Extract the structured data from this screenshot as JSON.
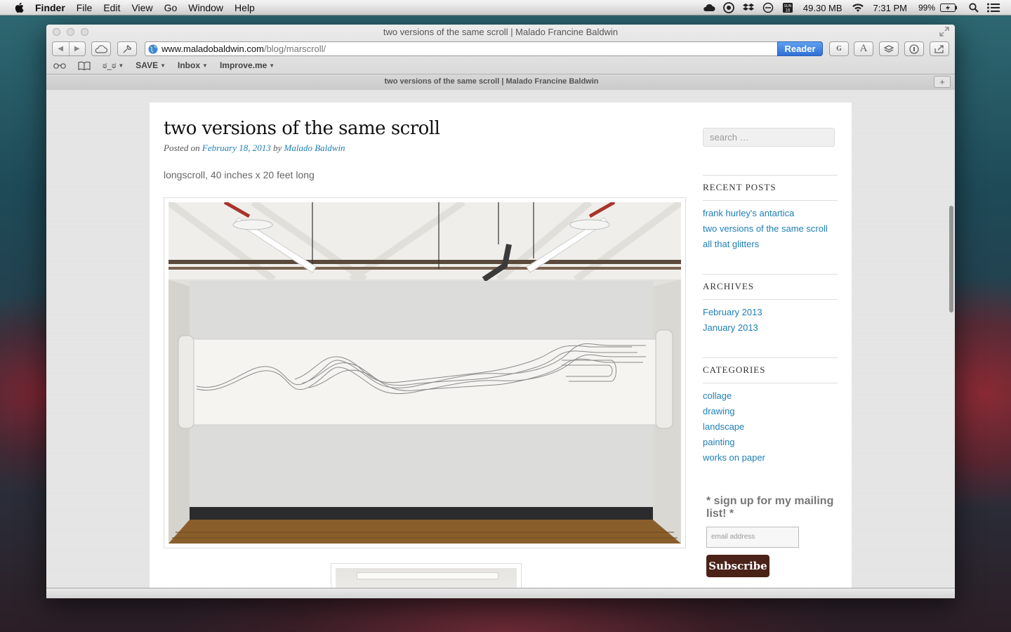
{
  "menubar": {
    "menus": [
      "Finder",
      "File",
      "Edit",
      "View",
      "Go",
      "Window",
      "Help"
    ],
    "memory": "49.30 MB",
    "time": "7:31 PM",
    "battery": "99%",
    "calendar_day": "SUN",
    "calendar_date": "16"
  },
  "browser": {
    "window_title": "two versions of the same scroll | Malado Francine Baldwin",
    "url_domain": "www.maladobaldwin.com",
    "url_path": "/blog/marscroll/",
    "reader_label": "Reader",
    "bookmarks": [
      {
        "label": "ಠ_ಠ",
        "dropdown": true
      },
      {
        "label": "SAVE",
        "dropdown": true
      },
      {
        "label": "Inbox",
        "dropdown": true
      },
      {
        "label": "Improve.me",
        "dropdown": true
      }
    ],
    "tab_title": "two versions of the same scroll | Malado Francine Baldwin",
    "new_tab": "+"
  },
  "post": {
    "title": "two versions of the same scroll",
    "posted_on_label": "Posted on",
    "date": "February 18, 2013",
    "by_label": "by",
    "author": "Malado Baldwin",
    "description": "longscroll, 40 inches x 20 feet long"
  },
  "sidebar": {
    "search_placeholder": "search …",
    "recent_posts_title": "RECENT POSTS",
    "recent_posts": [
      "frank hurley's antartica",
      "two versions of the same scroll",
      "all that glitters"
    ],
    "archives_title": "ARCHIVES",
    "archives": [
      "February 2013",
      "January 2013"
    ],
    "categories_title": "CATEGORIES",
    "categories": [
      "collage",
      "drawing",
      "landscape",
      "painting",
      "works on paper"
    ],
    "signup_text": "* sign up for my mailing list! *",
    "email_placeholder": "email address",
    "subscribe_label": "Subscribe"
  },
  "colors": {
    "link": "#1e7fb6",
    "reader_button": "#2e70d6",
    "subscribe_button": "#4b2218"
  }
}
